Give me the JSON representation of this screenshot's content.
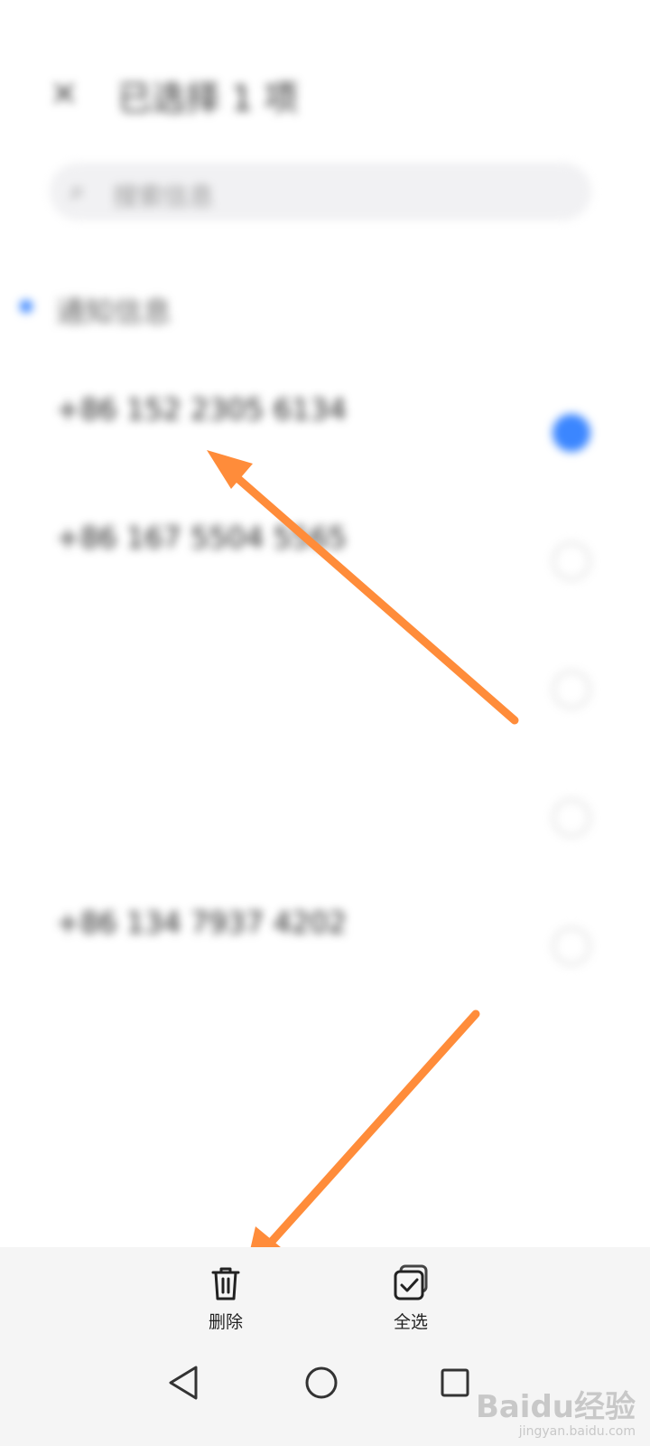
{
  "status_bar": {
    "left_text": "",
    "right_text": ""
  },
  "selection_header": {
    "title": "已选择 1 项"
  },
  "search": {
    "placeholder": "搜索信息"
  },
  "group": {
    "label": "通知信息",
    "extra": ""
  },
  "messages": [
    {
      "sender": "+86 152 2305 6134",
      "time": "",
      "tag": "",
      "preview": "",
      "selected": true
    },
    {
      "sender": "+86 167 5504 5565",
      "time": "",
      "tag": "",
      "preview": "",
      "selected": false
    },
    {
      "sender": "",
      "time": "",
      "tag": "",
      "preview": "",
      "selected": false
    },
    {
      "sender": "",
      "time": "",
      "tag": "",
      "preview": "",
      "selected": false
    },
    {
      "sender": "+86 134 7937 4202",
      "time": "",
      "tag": "",
      "preview": "",
      "selected": false
    }
  ],
  "action_bar": {
    "delete_label": "删除",
    "select_all_label": "全选",
    "delete_icon": "trash-icon",
    "select_all_icon": "select-all-icon"
  },
  "nav_bar": {
    "back_icon": "back-triangle-icon",
    "home_icon": "home-circle-icon",
    "recent_icon": "recent-square-icon"
  },
  "watermark": {
    "logo": "Baidu经验",
    "url": "jingyan.baidu.com"
  },
  "colors": {
    "accent": "#3b86ff",
    "annotation_arrow": "#ff8c3a",
    "tag_red": "#e53935"
  }
}
